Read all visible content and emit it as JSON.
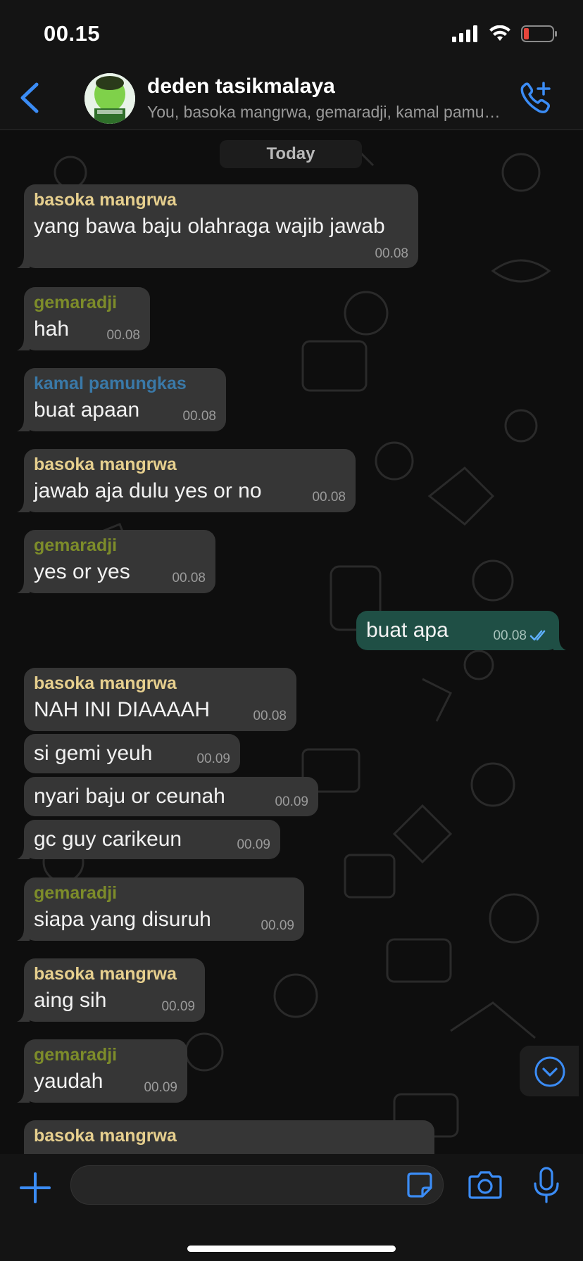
{
  "status_bar": {
    "time": "00.15"
  },
  "header": {
    "title": "deden tasikmalaya",
    "subtitle": "You, basoka mangrwa, gemaradji, kamal pamungkas"
  },
  "chat": {
    "date_label": "Today",
    "messages": [
      {
        "sender": "basoka mangrwa",
        "text": "yang bawa baju olahraga wajib jawab",
        "time": "00.08"
      },
      {
        "sender": "gemaradji",
        "text": "hah",
        "time": "00.08"
      },
      {
        "sender": "kamal pamungkas",
        "text": "buat apaan",
        "time": "00.08"
      },
      {
        "sender": "basoka mangrwa",
        "text": "jawab aja dulu yes or no",
        "time": "00.08"
      },
      {
        "sender": "gemaradji",
        "text": "yes or yes",
        "time": "00.08"
      },
      {
        "sender": "",
        "text": "buat apa",
        "time": "00.08",
        "outgoing": true
      },
      {
        "sender": "basoka mangrwa",
        "text": "NAH INI DIAAAAH",
        "time": "00.08"
      },
      {
        "sender": "",
        "text": "si gemi yeuh",
        "time": "00.09"
      },
      {
        "sender": "",
        "text": "nyari baju or ceunah",
        "time": "00.09"
      },
      {
        "sender": "",
        "text": "gc guy carikeun",
        "time": "00.09"
      },
      {
        "sender": "gemaradji",
        "text": "siapa yang disuruh",
        "time": "00.09"
      },
      {
        "sender": "basoka mangrwa",
        "text": "aing sih",
        "time": "00.09"
      },
      {
        "sender": "gemaradji",
        "text": "yaudah",
        "time": "00.09"
      },
      {
        "sender": "basoka mangrwa",
        "text": "",
        "time": ""
      }
    ]
  },
  "colors": {
    "accent": "#3b8cf5",
    "basoka": "#e6cf8e",
    "gemaradji": "#7d8c2a",
    "kamal": "#3a79a8",
    "incoming_bubble": "#363636",
    "outgoing_bubble": "#1f4f45"
  },
  "icons": [
    "back-chevron-icon",
    "group-avatar",
    "add-call-icon",
    "scroll-down-icon",
    "plus-icon",
    "sticker-icon",
    "camera-icon",
    "microphone-icon"
  ]
}
